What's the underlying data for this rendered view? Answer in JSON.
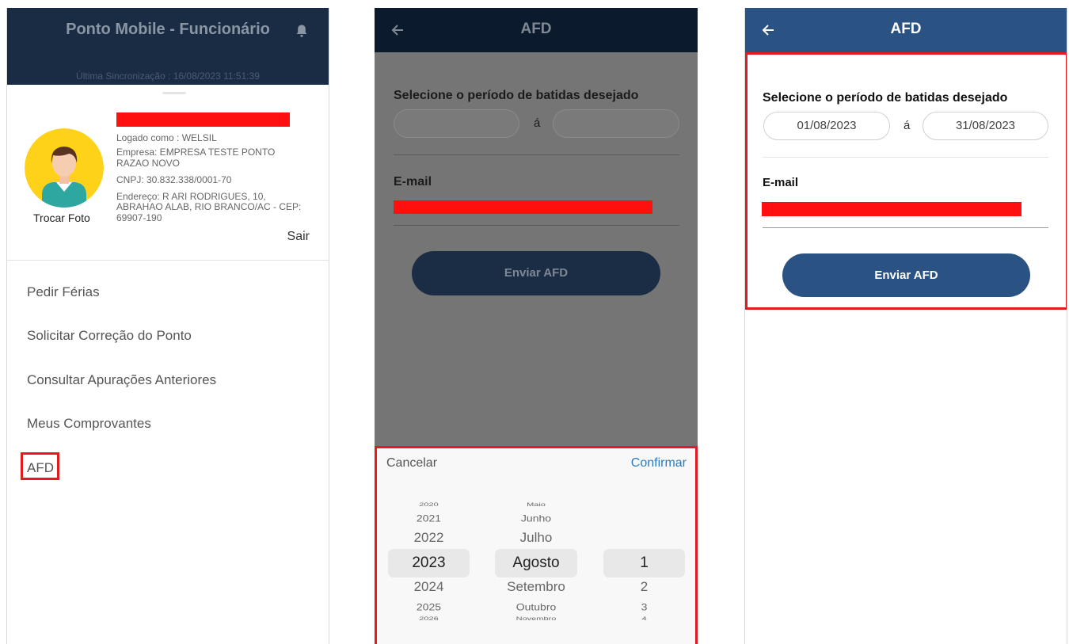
{
  "drawer": {
    "title": "Ponto Mobile - Funcionário",
    "icon": "bell-icon",
    "sync": "Última Sincronização : 16/08/2023 11:51:39",
    "change_photo": "Trocar Foto",
    "logged_as": "Logado como : WELSIL",
    "company_line1": "Empresa: EMPRESA TESTE PONTO",
    "company_line2": "RAZAO NOVO",
    "cnpj": "CNPJ: 30.832.338/0001-70",
    "address_line1": "Endereço: R ARI RODRIGUES, 10,",
    "address_line2": "ABRAHAO ALAB, RIO BRANCO/AC - CEP:",
    "address_line3": "69907-190",
    "logout": "Sair",
    "menu": [
      {
        "label": "Pedir Férias"
      },
      {
        "label": "Solicitar Correção do Ponto"
      },
      {
        "label": "Consultar Apurações Anteriores"
      },
      {
        "label": "Meus Comprovantes"
      },
      {
        "label": "AFD"
      }
    ]
  },
  "afd_picker": {
    "title": "AFD",
    "period_label": "Selecione o período de batidas desejado",
    "start_date": "",
    "separator": "á",
    "end_date": "",
    "email_label": "E-mail",
    "send_button": "Enviar AFD",
    "picker": {
      "cancel": "Cancelar",
      "confirm": "Confirmar",
      "years": [
        "2020",
        "2021",
        "2022",
        "2023",
        "2024",
        "2025",
        "2026"
      ],
      "months": [
        "Maio",
        "Junho",
        "Julho",
        "Agosto",
        "Setembro",
        "Outubro",
        "Novembro"
      ],
      "days": [
        "1",
        "2",
        "3",
        "4"
      ],
      "selected": {
        "year": "2023",
        "month": "Agosto",
        "day": "1"
      }
    }
  },
  "afd_filled": {
    "title": "AFD",
    "period_label": "Selecione o período de batidas desejado",
    "start_date": "01/08/2023",
    "separator": "á",
    "end_date": "31/08/2023",
    "email_label": "E-mail",
    "send_button": "Enviar AFD"
  },
  "colors": {
    "header_dark": "#1a2b44",
    "primary": "#2a5282",
    "highlight": "#e21b22",
    "redaction": "#ff1010",
    "link": "#2b7bbf"
  }
}
